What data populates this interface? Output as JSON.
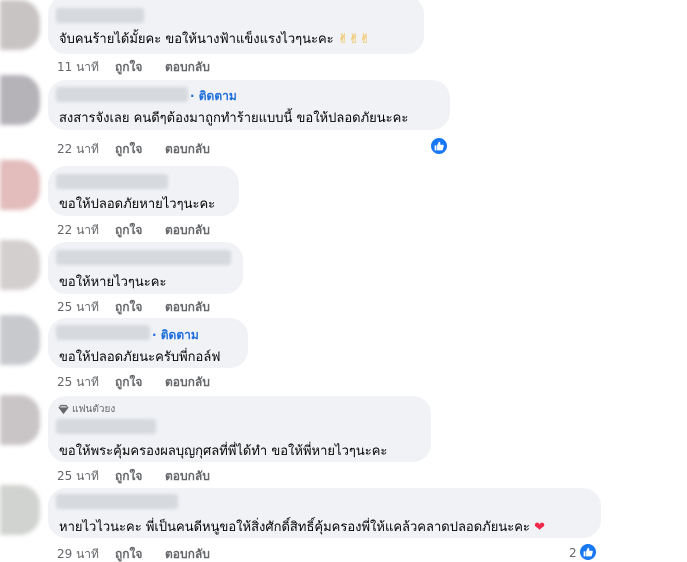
{
  "comments": [
    {
      "follow": "",
      "badge": "",
      "text": "จับคนร้ายได้มั้ยคะ ขอให้นางฟ้าแข็งแรงไวๆนะคะ",
      "text_emoji": "✌✌✌",
      "time": "11 นาที",
      "like": "ถูกใจ",
      "reply": "ตอบกลับ",
      "reaction_count": ""
    },
    {
      "follow": "· ติดตาม",
      "badge": "",
      "text": "สงสารจังเลย คนดีๆต้องมาถูกทำร้ายแบบนี้ ขอให้ปลอดภัยนะคะ",
      "text_emoji": "",
      "time": "22 นาที",
      "like": "ถูกใจ",
      "reply": "ตอบกลับ",
      "reaction_count": ""
    },
    {
      "follow": "",
      "badge": "",
      "text": "ขอให้ปลอดภัยหายไวๆนะคะ",
      "text_emoji": "",
      "time": "22 นาที",
      "like": "ถูกใจ",
      "reply": "ตอบกลับ",
      "reaction_count": ""
    },
    {
      "follow": "",
      "badge": "",
      "text": "ขอให้หายไวๆนะคะ",
      "text_emoji": "",
      "time": "25 นาที",
      "like": "ถูกใจ",
      "reply": "ตอบกลับ",
      "reaction_count": ""
    },
    {
      "follow": "· ติดตาม",
      "badge": "",
      "text": "ขอให้ปลอดภัยนะครับพี่กอล์ฟ",
      "text_emoji": "",
      "time": "25 นาที",
      "like": "ถูกใจ",
      "reply": "ตอบกลับ",
      "reaction_count": ""
    },
    {
      "follow": "",
      "badge": "แฟนตัวยง",
      "text": "ขอให้พระคุ้มครองผลบุญกุศลที่พี่ได้ทำ ขอให้พี่หายไวๆนะคะ",
      "text_emoji": "",
      "time": "25 นาที",
      "like": "ถูกใจ",
      "reply": "ตอบกลับ",
      "reaction_count": ""
    },
    {
      "follow": "",
      "badge": "",
      "text": "หายไวไวนะคะ พี่เป็นคนดีหนูขอให้สิ่งศักดิ์สิทธิ์คุ้มครองพี่ให้แคล้วคลาดปลอดภัยนะคะ",
      "text_emoji": "❤",
      "time": "29 นาที",
      "like": "ถูกใจ",
      "reply": "ตอบกลับ",
      "reaction_count": "2"
    }
  ],
  "colors": {
    "bubble": "#f0f2f5",
    "link": "#216fdb",
    "meta": "#65676b",
    "like_reaction": "#1877f2"
  },
  "icons": [
    "like-reaction-icon",
    "fan-badge-icon"
  ]
}
